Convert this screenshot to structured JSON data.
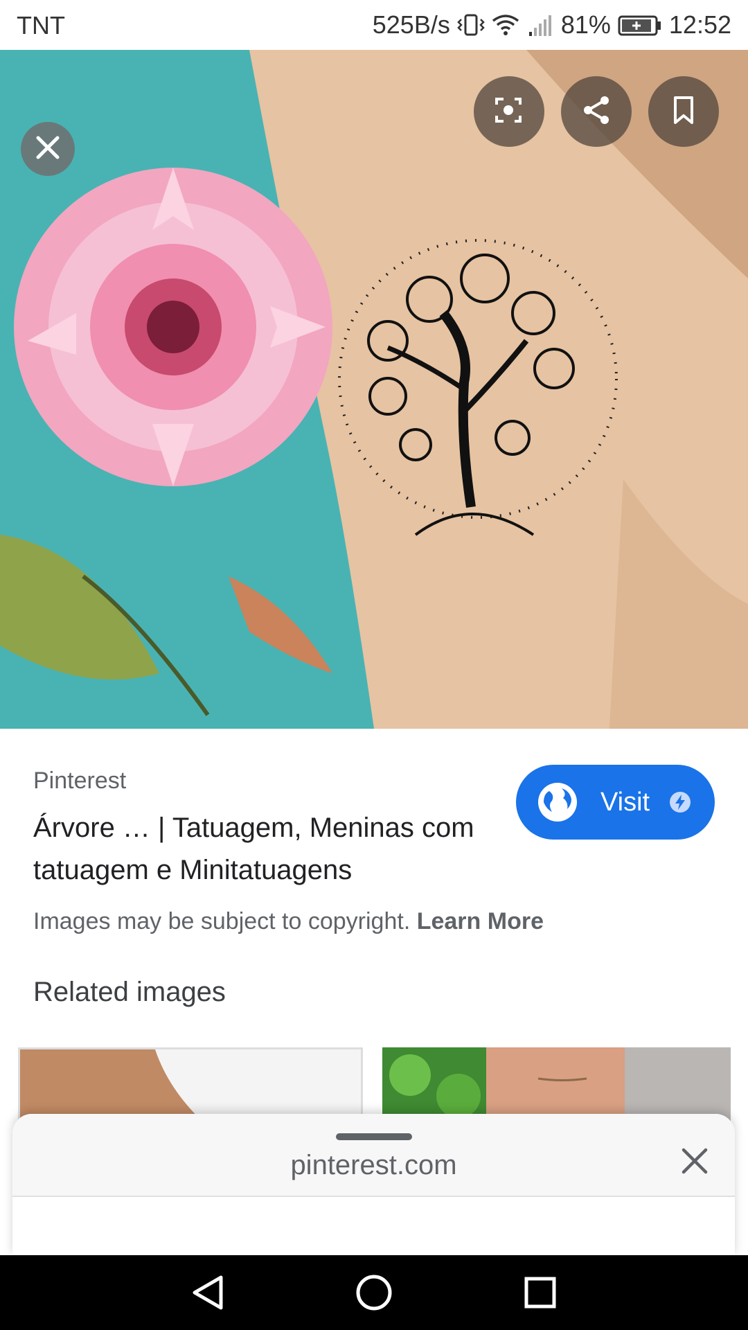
{
  "status_bar": {
    "carrier": "TNT",
    "net_speed": "525B/s",
    "battery_percent": "81%",
    "time": "12:52",
    "icons": [
      "vibrate-icon",
      "wifi-icon",
      "signal-icon",
      "battery-icon"
    ]
  },
  "hero": {
    "close_icon": "close-icon",
    "actions": [
      "lens-icon",
      "share-icon",
      "bookmark-icon"
    ]
  },
  "result": {
    "source": "Pinterest",
    "title": "Árvore … | Tatuagem, Meninas com tatuagem e Minitatuagens",
    "visit_label": "Visit",
    "copyright_text": "Images may be subject to copyright.",
    "learn_more": "Learn More"
  },
  "related": {
    "heading": "Related images"
  },
  "sheet": {
    "domain": "pinterest.com"
  },
  "nav": {
    "buttons": [
      "back-icon",
      "home-icon",
      "recents-icon"
    ]
  },
  "colors": {
    "accent": "#1a73e8",
    "secondary_text": "#5f6368"
  }
}
